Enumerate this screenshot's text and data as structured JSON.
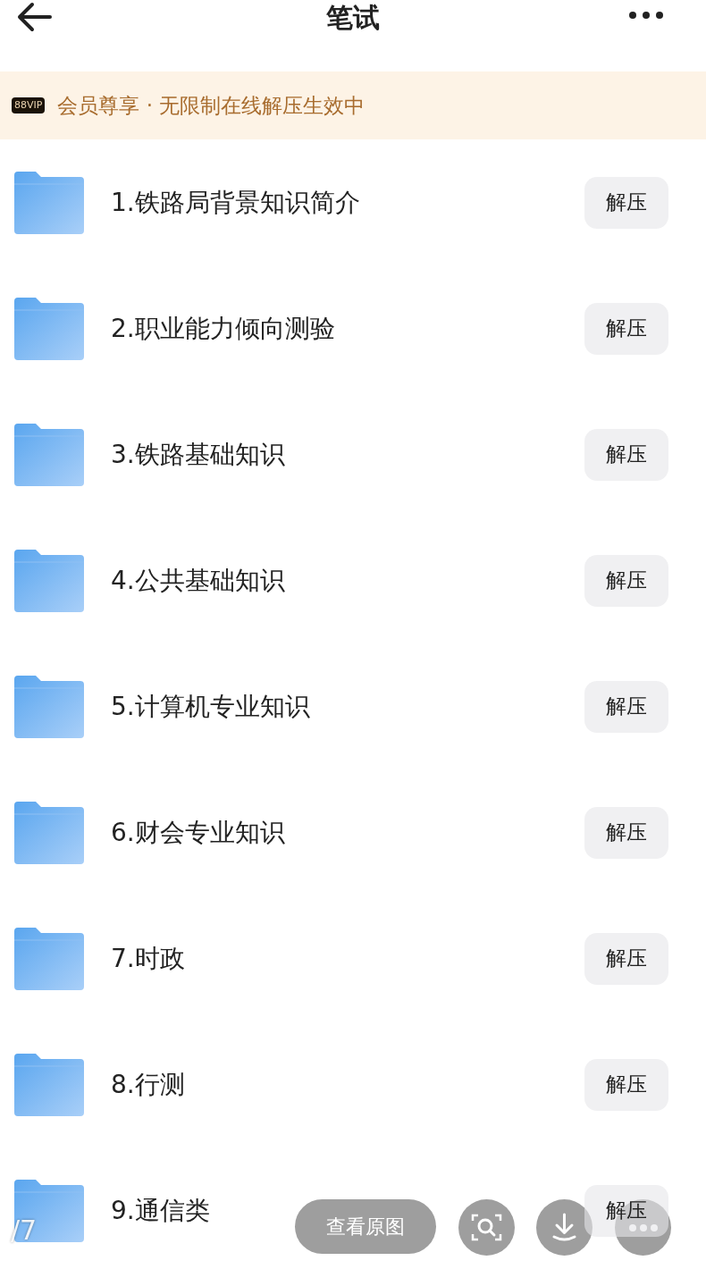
{
  "header": {
    "title": "笔试"
  },
  "banner": {
    "badge": "88VIP",
    "text": "会员尊享 · 无限制在线解压生效中"
  },
  "files": [
    {
      "name": "1.铁路局背景知识简介",
      "action": "解压"
    },
    {
      "name": "2.职业能力倾向测验",
      "action": "解压"
    },
    {
      "name": "3.铁路基础知识",
      "action": "解压"
    },
    {
      "name": "4.公共基础知识",
      "action": "解压"
    },
    {
      "name": "5.计算机专业知识",
      "action": "解压"
    },
    {
      "name": "6.财会专业知识",
      "action": "解压"
    },
    {
      "name": "7.时政",
      "action": "解压"
    },
    {
      "name": "8.行测",
      "action": "解压"
    },
    {
      "name": "9.通信类",
      "action": "解压"
    }
  ],
  "viewer": {
    "counter": "/7",
    "view_original": "查看原图"
  }
}
